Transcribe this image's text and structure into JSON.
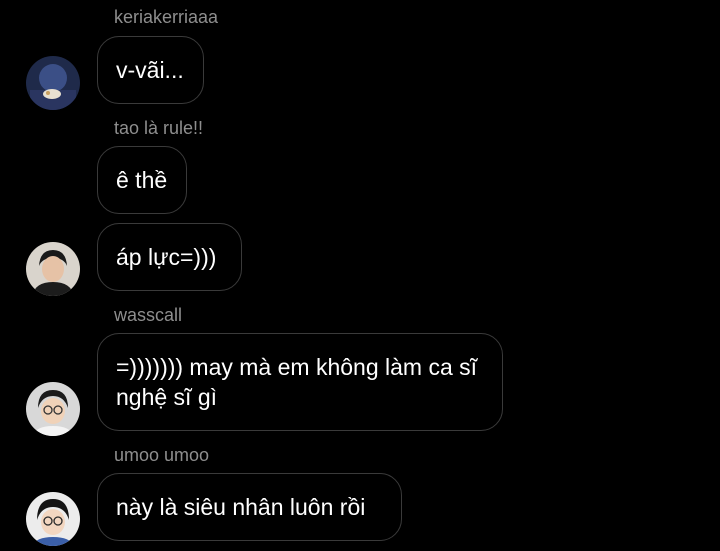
{
  "messages": [
    {
      "sender": "keriakerriaaa",
      "text": "v-vãi..."
    },
    {
      "sender": "tao là rule!!",
      "text": "ê thề"
    },
    {
      "sender": "",
      "text": "áp lực=)))"
    },
    {
      "sender": "wasscall",
      "text": "=))))))) may mà em không làm ca sĩ nghệ sĩ gì"
    },
    {
      "sender": "umoo umoo",
      "text": "này là siêu nhân luôn rồi"
    }
  ],
  "colors": {
    "background": "#000000",
    "bubble_border": "#3a3a3a",
    "sender_text": "#8e8e8e",
    "message_text": "#ffffff"
  }
}
